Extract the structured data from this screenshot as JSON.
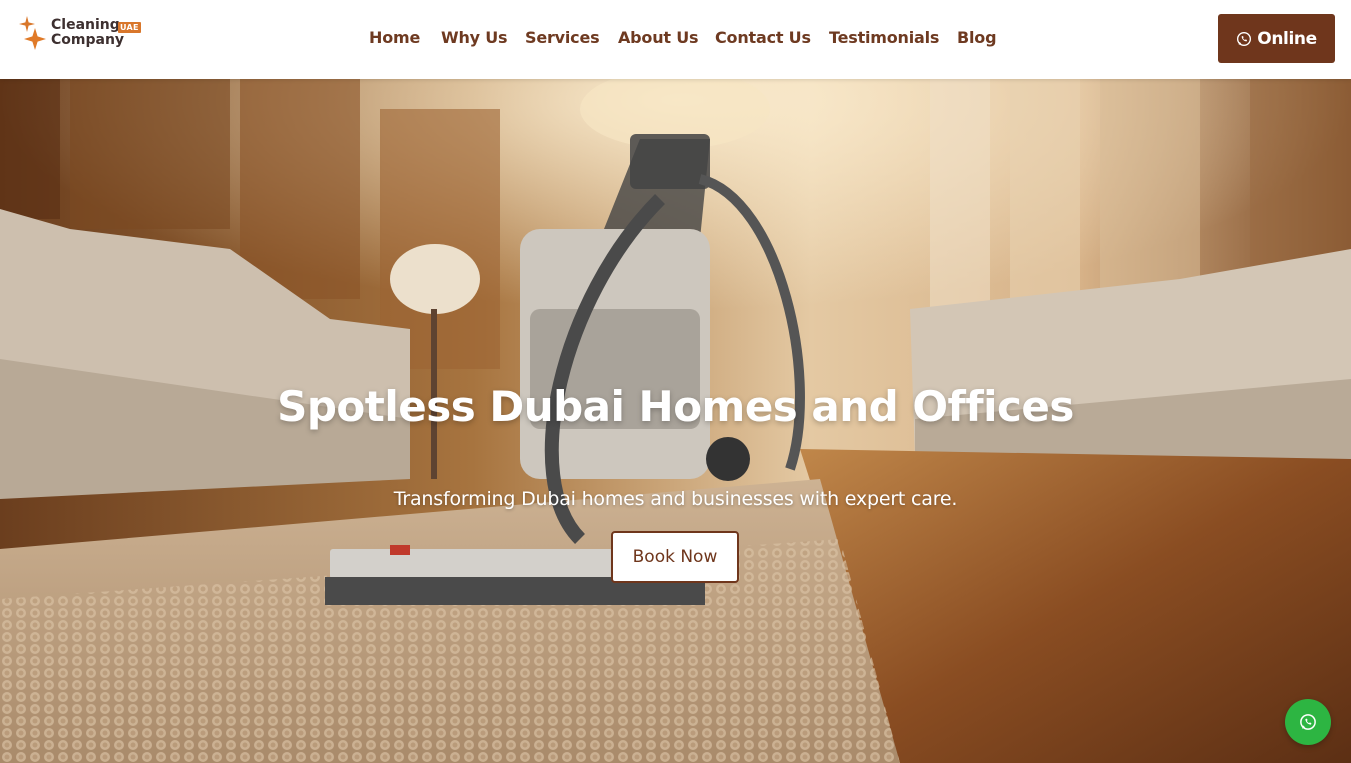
{
  "brand": {
    "name_line1": "Cleaning",
    "name_line2": "Company",
    "badge": "UAE",
    "accent": "#d9772b"
  },
  "nav": {
    "items": [
      {
        "label": "Home"
      },
      {
        "label": "Why Us"
      },
      {
        "label": "Services"
      },
      {
        "label": "About Us"
      },
      {
        "label": "Contact Us"
      },
      {
        "label": "Testimonials"
      },
      {
        "label": "Blog"
      }
    ],
    "color": "#6e3a21"
  },
  "header_cta": {
    "label": "Online",
    "icon": "whatsapp-icon",
    "background": "#6f361c"
  },
  "hero": {
    "title": "Spotless Dubai Homes and Offices",
    "subtitle": "Transforming Dubai homes and businesses with expert care.",
    "button_label": "Book Now",
    "image": "vacuum-cleaner-on-carpet-in-living-room"
  },
  "floating_chat": {
    "icon": "whatsapp-icon",
    "color": "#2db542"
  }
}
